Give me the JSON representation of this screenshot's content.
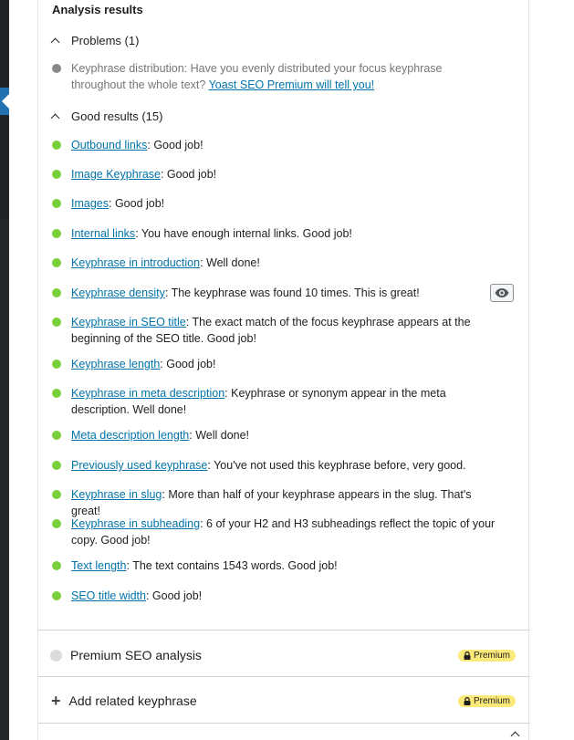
{
  "analysis": {
    "title": "Analysis results",
    "problems_heading": "Problems (1)",
    "problems": [
      {
        "prefix": "Keyphrase distribution: Have you evenly distributed your focus keyphrase throughout the whole text? ",
        "link": "Yoast SEO Premium will tell you!",
        "suffix": ""
      }
    ],
    "good_heading": "Good results (15)",
    "good": [
      {
        "link": "Outbound links",
        "text": ": Good job!"
      },
      {
        "link": "Image Keyphrase",
        "text": ": Good job!"
      },
      {
        "link": "Images",
        "text": ": Good job!"
      },
      {
        "link": "Internal links",
        "text": ": You have enough internal links. Good job!"
      },
      {
        "link": "Keyphrase in introduction",
        "text": ": Well done!"
      },
      {
        "link": "Keyphrase density",
        "text": ": The keyphrase was found 10 times. This is great!"
      },
      {
        "link": "Keyphrase in SEO title",
        "text": ": The exact match of the focus keyphrase appears at the beginning of the SEO title. Good job!"
      },
      {
        "link": "Keyphrase length",
        "text": ": Good job!"
      },
      {
        "link": "Keyphrase in meta description",
        "text": ": Keyphrase or synonym appear in the meta description. Well done!"
      },
      {
        "link": "Meta description length",
        "text": ": Well done!"
      },
      {
        "link": "Previously used keyphrase",
        "text": ": You've not used this keyphrase before, very good."
      },
      {
        "link": "Keyphrase in slug",
        "text": ": More than half of your keyphrase appears in the slug. That's great!"
      },
      {
        "link": "Keyphrase in subheading",
        "text": ": 6 of your H2 and H3 subheadings reflect the topic of your copy. Good job!"
      },
      {
        "link": "Text length",
        "text": ": The text contains 1543 words. Good job!"
      },
      {
        "link": "SEO title width",
        "text": ": Good job!"
      }
    ]
  },
  "premium_analysis": {
    "label": "Premium SEO analysis",
    "badge": "Premium"
  },
  "related_keyphrase": {
    "label": "Add related keyphrase",
    "badge": "Premium"
  },
  "colors": {
    "good": "#7ad03a",
    "problem": "#888888",
    "link": "#0073aa",
    "badge": "#fbe97a"
  },
  "icons": {
    "eye_button": "eye-icon",
    "lock": "lock-icon",
    "add": "plus-icon"
  }
}
